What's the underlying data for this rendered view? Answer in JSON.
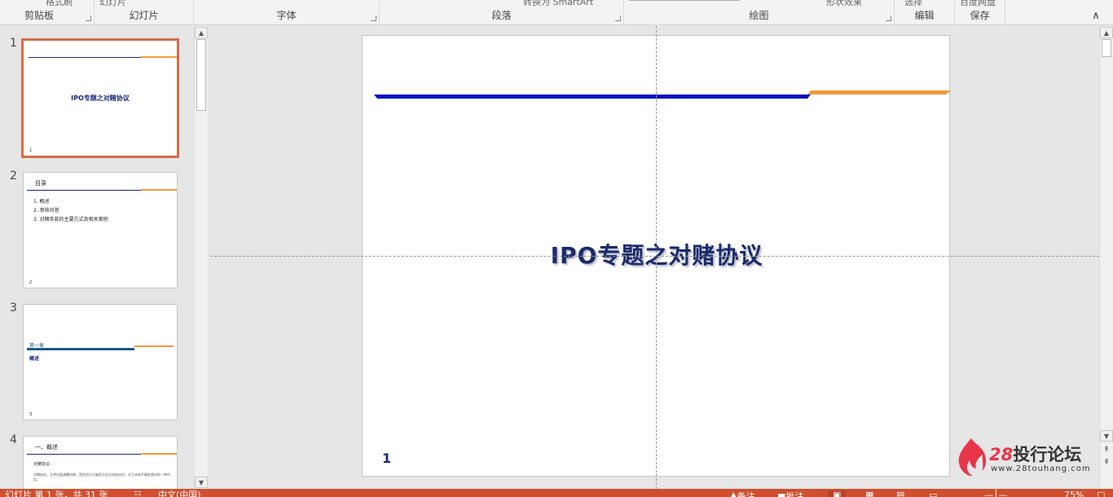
{
  "ribbon": {
    "groups": [
      {
        "label": "剪贴板",
        "cut_text": "格式刷"
      },
      {
        "label": "幻灯片",
        "cut_text": "幻灯片"
      },
      {
        "label": "字体",
        "cut_text": ""
      },
      {
        "label": "段落",
        "cut_text": "转换为 SmartArt"
      },
      {
        "label": "绘图",
        "cut_text": "形状效果"
      },
      {
        "label": "编辑",
        "cut_text": "选择"
      },
      {
        "label": "保存",
        "cut_text": "百度网盘"
      }
    ],
    "collapse_icon": "chevron-up-icon"
  },
  "thumbnails": [
    {
      "number": "1",
      "title": "IPO专题之对赌协议",
      "page": "1"
    },
    {
      "number": "2",
      "heading": "目录",
      "items": [
        "1. 概述",
        "2. 审核问答",
        "3. 对赌条款的主要方式及相关案例"
      ],
      "page": "2"
    },
    {
      "number": "3",
      "heading": "第一章",
      "subheading": "概述",
      "page": "3"
    },
    {
      "number": "4",
      "heading": "一、概述",
      "subheading": "对赌协议：",
      "body": "对赌协议，又称估值调整机制，是投资方与融资方在达成协议时，对于未来不确定情况的一种约定。",
      "page": "4"
    }
  ],
  "slide": {
    "title": "IPO专题之对赌协议",
    "page_number": "1",
    "accent_colors": {
      "blue": "#0010c0",
      "orange": "#f29a3a"
    }
  },
  "watermark": {
    "number": "28",
    "name": "投行论坛",
    "url": "www.28touhang.com"
  },
  "status": {
    "slide_info": "幻灯片 第 1 张，共 31 张",
    "language": "中文(中国)",
    "notes": "备注",
    "comments": "批注",
    "zoom": "75%"
  }
}
